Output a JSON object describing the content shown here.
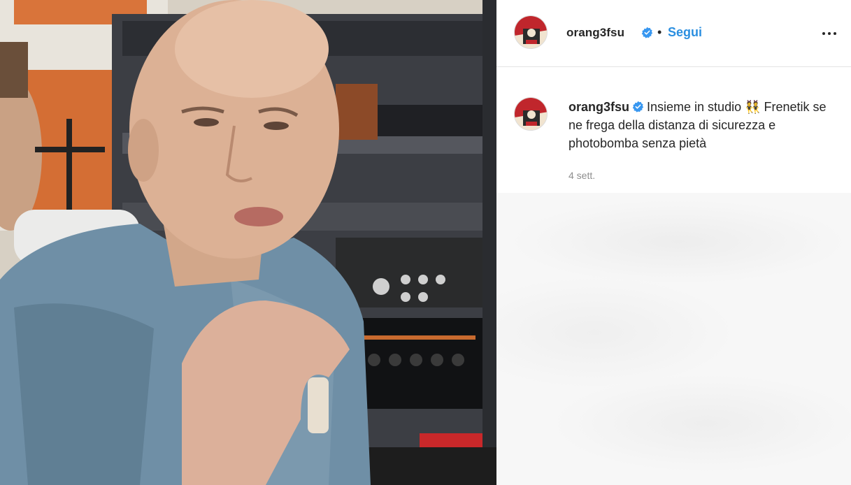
{
  "post": {
    "username": "orang3fsu",
    "separator": "•",
    "follow_label": "Segui",
    "more_label": "...",
    "caption_text": "Insieme in studio 👯 Frenetik se ne frega della distanza di sicurezza e photobomba senza pietà",
    "timestamp": "4 sett."
  },
  "colors": {
    "follow_blue": "#2b8fe0",
    "verified_blue": "#3897f0",
    "text_primary": "#262626",
    "text_secondary": "#8e8e8e",
    "divider": "#e3e3e3"
  },
  "icons": {
    "verified": "verified-badge-icon",
    "more": "more-options-icon"
  }
}
